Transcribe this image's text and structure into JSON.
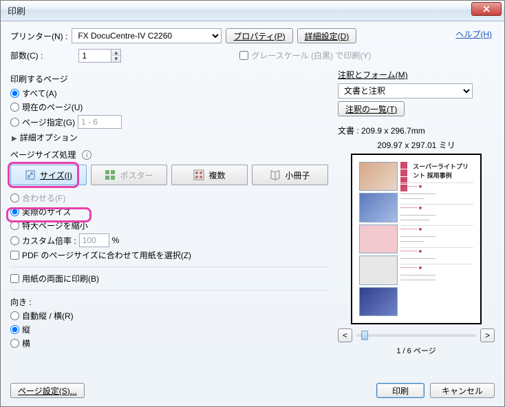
{
  "window": {
    "title": "印刷"
  },
  "help_link": "ヘルプ(H)",
  "printer": {
    "label": "プリンター(N) :",
    "selected": "FX DocuCentre-IV C2260",
    "properties_btn": "プロパティ(P)",
    "advanced_btn": "詳細設定(D)"
  },
  "copies": {
    "label": "部数(C) :",
    "value": "1"
  },
  "grayscale": {
    "label": "グレースケール (白黒) で印刷(Y)",
    "checked": false
  },
  "page_range": {
    "title": "印刷するページ",
    "all": "すべて(A)",
    "current": "現在のページ(U)",
    "pages": "ページ指定(G)",
    "pages_value": "1 - 6",
    "more": "詳細オプション"
  },
  "size_handling": {
    "title": "ページサイズ処理",
    "size_btn": "サイズ(I)",
    "poster_btn": "ポスター",
    "multiple_btn": "複数",
    "booklet_btn": "小冊子"
  },
  "size_opts": {
    "fit": "合わせる(F)",
    "actual": "実際のサイズ",
    "shrink": "特大ページを縮小",
    "custom": "カスタム倍率 :",
    "custom_value": "100",
    "custom_unit": "%",
    "choose_paper": "PDF のページサイズに合わせて用紙を選択(Z)"
  },
  "duplex": {
    "label": "用紙の両面に印刷(B)"
  },
  "orient": {
    "title": "向き :",
    "auto": "自動縦 / 横(R)",
    "portrait": "縦",
    "landscape": "横"
  },
  "annotations": {
    "title": "注釈とフォーム(M)",
    "selected": "文書と注釈",
    "summary_btn": "注釈の一覧(T)"
  },
  "preview": {
    "doc_dim": "文書 : 209.9 x 296.7mm",
    "paper_dim": "209.97 x 297.01 ミリ",
    "prev_btn": "<",
    "next_btn": ">",
    "page_info": "1 / 6 ページ",
    "doc_title": "スーパーライトプリント 採用事例"
  },
  "footer": {
    "page_setup": "ページ設定(S)...",
    "print": "印刷",
    "cancel": "キャンセル"
  }
}
